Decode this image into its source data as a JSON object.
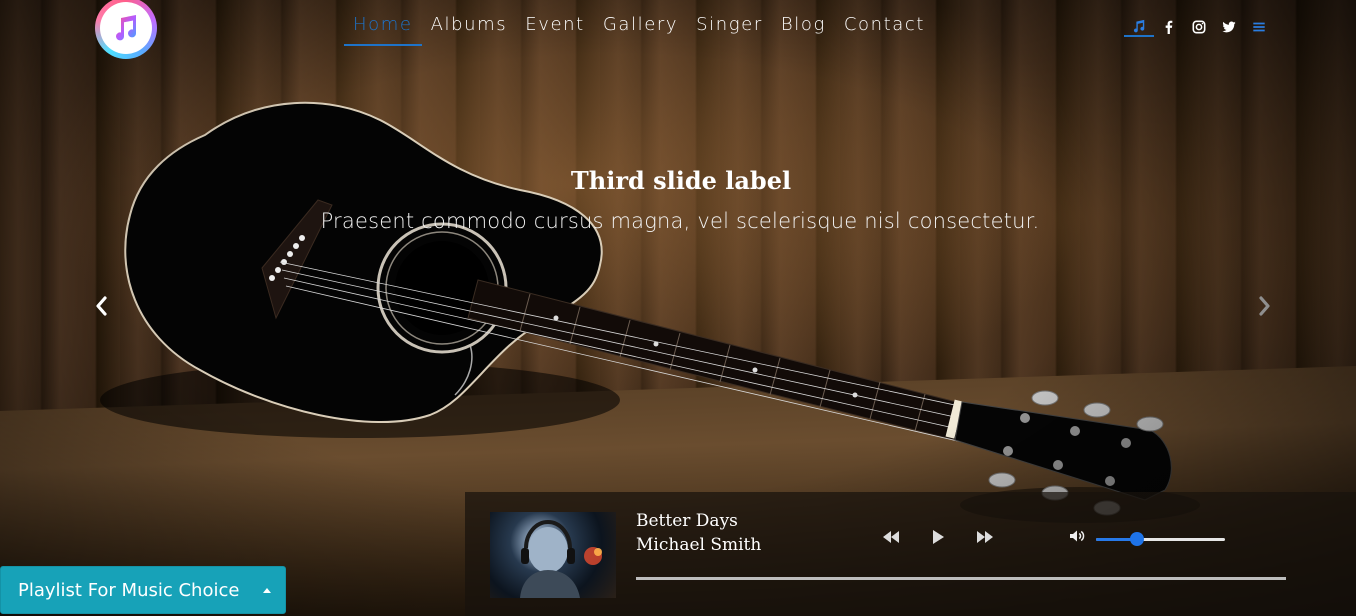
{
  "brand": {
    "logo_icon": "music-note-icon"
  },
  "nav": {
    "items": [
      {
        "label": "Home",
        "active": true
      },
      {
        "label": "Albums",
        "active": false
      },
      {
        "label": "Event",
        "active": false
      },
      {
        "label": "Gallery",
        "active": false
      },
      {
        "label": "Singer",
        "active": false
      },
      {
        "label": "Blog",
        "active": false
      },
      {
        "label": "Contact",
        "active": false
      }
    ],
    "active_color": "#1e73c9"
  },
  "social": {
    "icons": [
      "music-note-icon",
      "facebook-icon",
      "instagram-icon",
      "twitter-icon",
      "menu-icon"
    ],
    "active": "music-note-icon"
  },
  "carousel": {
    "caption_title": "Third slide label",
    "caption_text": "Praesent commodo cursus magna, vel scelerisque nisl consectetur.",
    "prev_icon": "chevron-left-icon",
    "next_icon": "chevron-right-icon"
  },
  "player": {
    "track_title": "Better Days",
    "artist": "Michael Smith",
    "controls": [
      "rewind-icon",
      "play-icon",
      "fast-forward-icon"
    ],
    "volume_icon": "volume-icon",
    "volume_level": 0.32,
    "progress": 0.0,
    "accent_color": "#1e73e8"
  },
  "playlist": {
    "label": "Playlist For Music Choice",
    "caret_icon": "caret-up-icon",
    "color": "#17a2b8"
  }
}
